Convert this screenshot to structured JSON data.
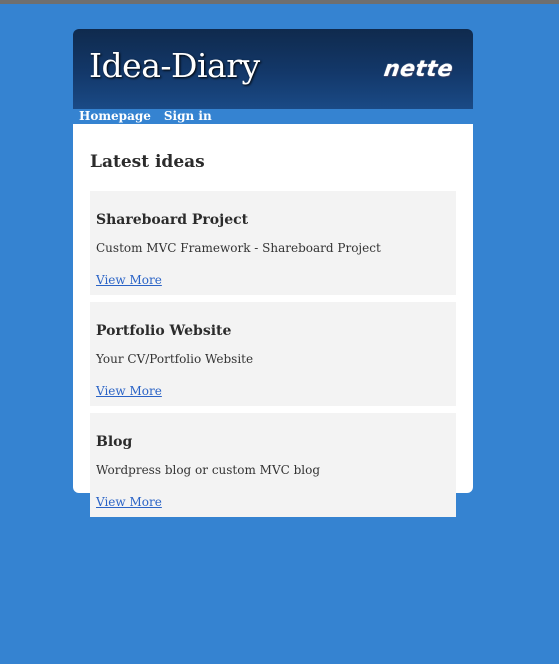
{
  "site": {
    "title": "Idea-Diary",
    "logo_text": "nette"
  },
  "nav": {
    "items": [
      "Homepage",
      "Sign in"
    ]
  },
  "main": {
    "heading": "Latest ideas",
    "ideas": [
      {
        "title": "Shareboard Project",
        "description": "Custom MVC Framework - Shareboard Project",
        "link_label": "View More"
      },
      {
        "title": "Portfolio Website",
        "description": "Your CV/Portfolio Website",
        "link_label": "View More"
      },
      {
        "title": "Blog",
        "description": "Wordpress blog or custom MVC blog",
        "link_label": "View More"
      }
    ]
  }
}
